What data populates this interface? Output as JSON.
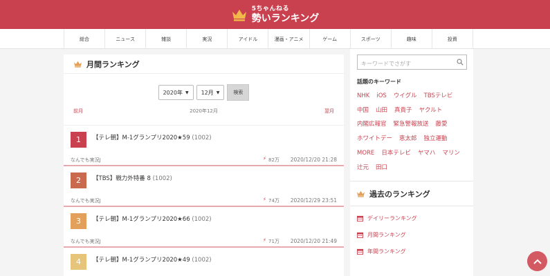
{
  "site": {
    "title_small": "5ちゃんねる",
    "title_big": "勢いランキング"
  },
  "nav": {
    "items": [
      "総合",
      "ニュース",
      "雑談",
      "実況",
      "アイドル",
      "漫画・アニメ",
      "ゲーム",
      "スポーツ",
      "趣味",
      "投資"
    ]
  },
  "main": {
    "title": "月間ランキング",
    "year_value": "2020年",
    "month_value": "12月",
    "search_label": "検索",
    "prev_label": "前月",
    "current_label": "2020年12月",
    "next_label": "翌月"
  },
  "rankings": [
    {
      "rank": "1",
      "title": "【テレ朝】M-1グランプリ2020★59",
      "count": "(1002)",
      "board": "なんでも実況J",
      "views": "82万",
      "date": "2020/12/20 21:28",
      "color": "#c9414f"
    },
    {
      "rank": "2",
      "title": "【TBS】戦力外特番 8",
      "count": "(1002)",
      "board": "なんでも実況J",
      "views": "74万",
      "date": "2020/12/29 23:51",
      "color": "#c96a4f"
    },
    {
      "rank": "3",
      "title": "【テレ朝】M-1グランプリ2020★66",
      "count": "(1002)",
      "board": "なんでも実況J",
      "views": "71万",
      "date": "2020/12/20 21:49",
      "color": "#e3a05a"
    },
    {
      "rank": "4",
      "title": "【テレ朝】M-1グランプリ2020★49",
      "count": "(1002)",
      "board": "",
      "views": "",
      "date": "",
      "color": "#e6c57a"
    }
  ],
  "sidebar": {
    "search_placeholder": "キーワードでさがす",
    "keywords_title": "話題のキーワード",
    "keywords": [
      "NHK",
      "iOS",
      "ウイグル",
      "TBSテレビ",
      "中国",
      "山田",
      "真貴子",
      "ヤクルト",
      "内閣広報官",
      "緊急警報放送",
      "藤愛",
      "ホワイトデー",
      "恵太郎",
      "独立運動",
      "MORE",
      "日本テレビ",
      "ヤマハ",
      "マリン",
      "辻元",
      "田口"
    ],
    "past_title": "過去のランキング",
    "past_links": [
      "デイリーランキング",
      "月間ランキング",
      "年間ランキング"
    ]
  },
  "colors": {
    "brand": "#c9414f",
    "gold": "#e3a05a"
  }
}
